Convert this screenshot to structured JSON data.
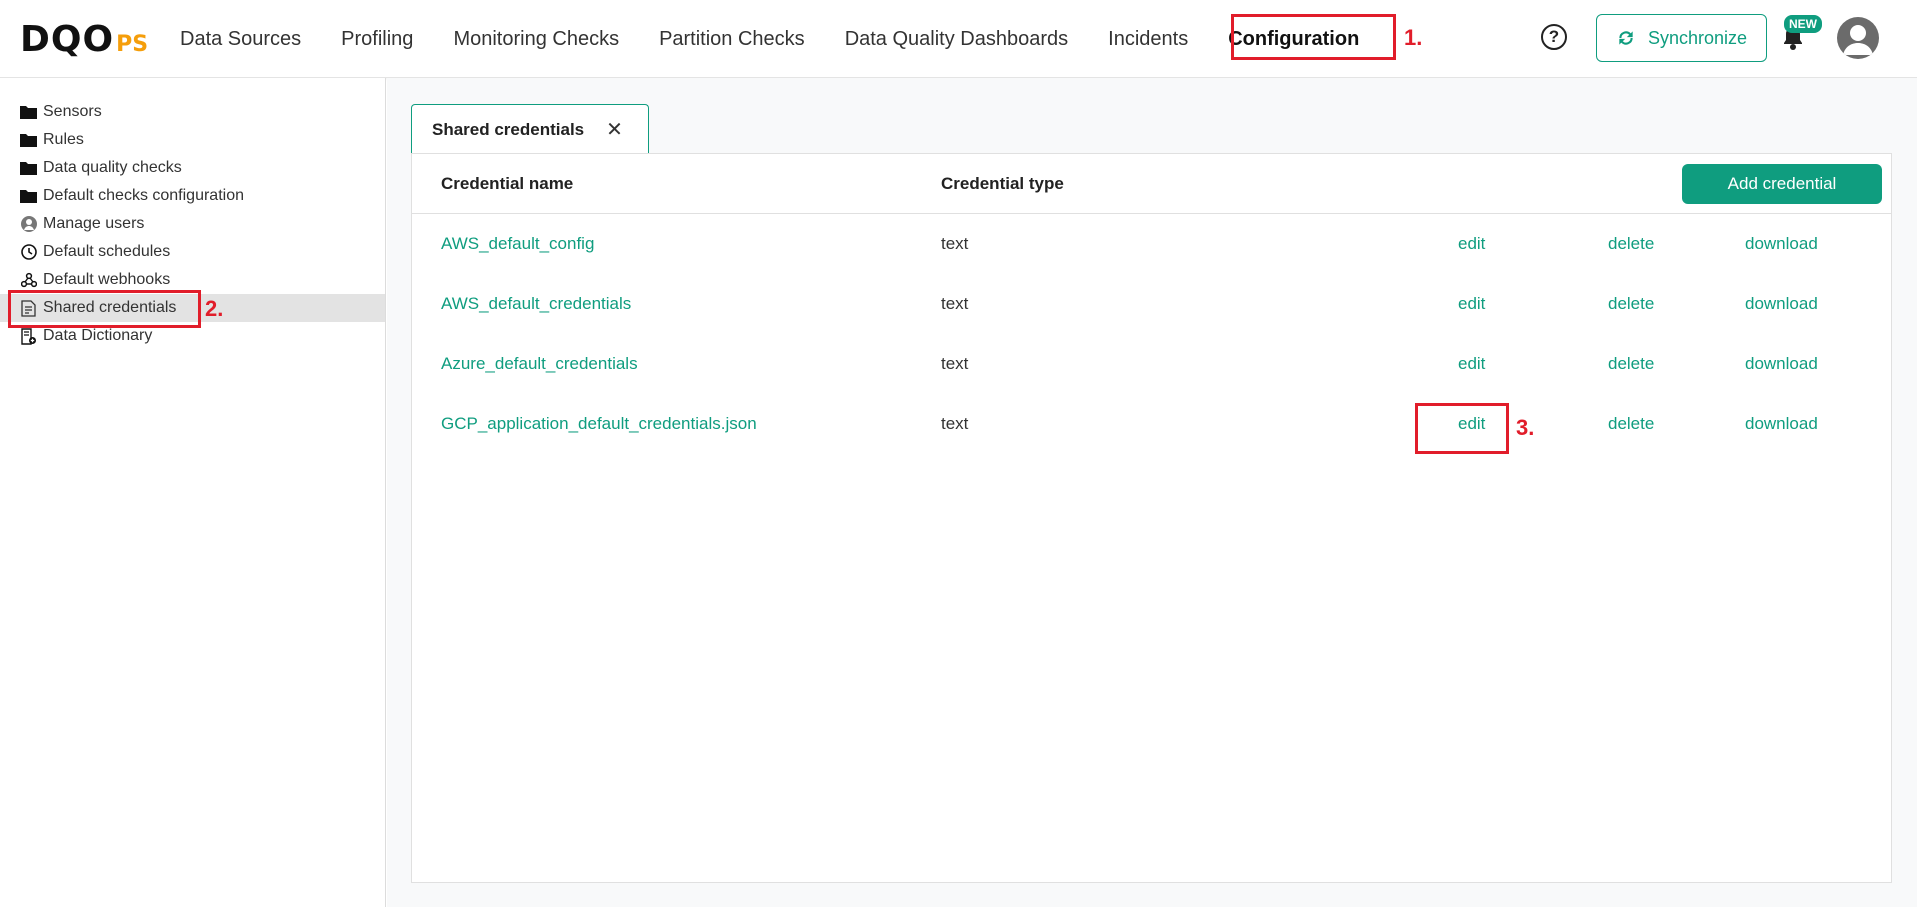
{
  "logo": {
    "main": "DQO",
    "suffix": "PS"
  },
  "nav": [
    {
      "label": "Data Sources"
    },
    {
      "label": "Profiling"
    },
    {
      "label": "Monitoring Checks"
    },
    {
      "label": "Partition Checks"
    },
    {
      "label": "Data Quality Dashboards"
    },
    {
      "label": "Incidents"
    },
    {
      "label": "Configuration"
    }
  ],
  "header": {
    "help": "?",
    "sync_label": "Synchronize",
    "new_badge": "NEW"
  },
  "annotations": {
    "one": "1.",
    "two": "2.",
    "three": "3."
  },
  "sidebar": {
    "items": [
      {
        "label": "Sensors",
        "icon": "folder-icon"
      },
      {
        "label": "Rules",
        "icon": "folder-icon"
      },
      {
        "label": "Data quality checks",
        "icon": "folder-icon"
      },
      {
        "label": "Default checks configuration",
        "icon": "folder-icon"
      },
      {
        "label": "Manage users",
        "icon": "user-icon"
      },
      {
        "label": "Default schedules",
        "icon": "clock-icon"
      },
      {
        "label": "Default webhooks",
        "icon": "webhook-icon"
      },
      {
        "label": "Shared credentials",
        "icon": "document-icon"
      },
      {
        "label": "Data Dictionary",
        "icon": "dictionary-icon"
      }
    ]
  },
  "tab": {
    "label": "Shared credentials",
    "close": "✕"
  },
  "table": {
    "headers": {
      "name": "Credential name",
      "type": "Credential type"
    },
    "add_button": "Add credential",
    "actions": {
      "edit": "edit",
      "delete": "delete",
      "download": "download"
    },
    "rows": [
      {
        "name": "AWS_default_config",
        "type": "text"
      },
      {
        "name": "AWS_default_credentials",
        "type": "text"
      },
      {
        "name": "Azure_default_credentials",
        "type": "text"
      },
      {
        "name": "GCP_application_default_credentials.json",
        "type": "text"
      }
    ]
  },
  "colors": {
    "accent": "#0f9d7f",
    "annotation": "#e11d2a",
    "logo_suffix": "#f59e0b"
  }
}
